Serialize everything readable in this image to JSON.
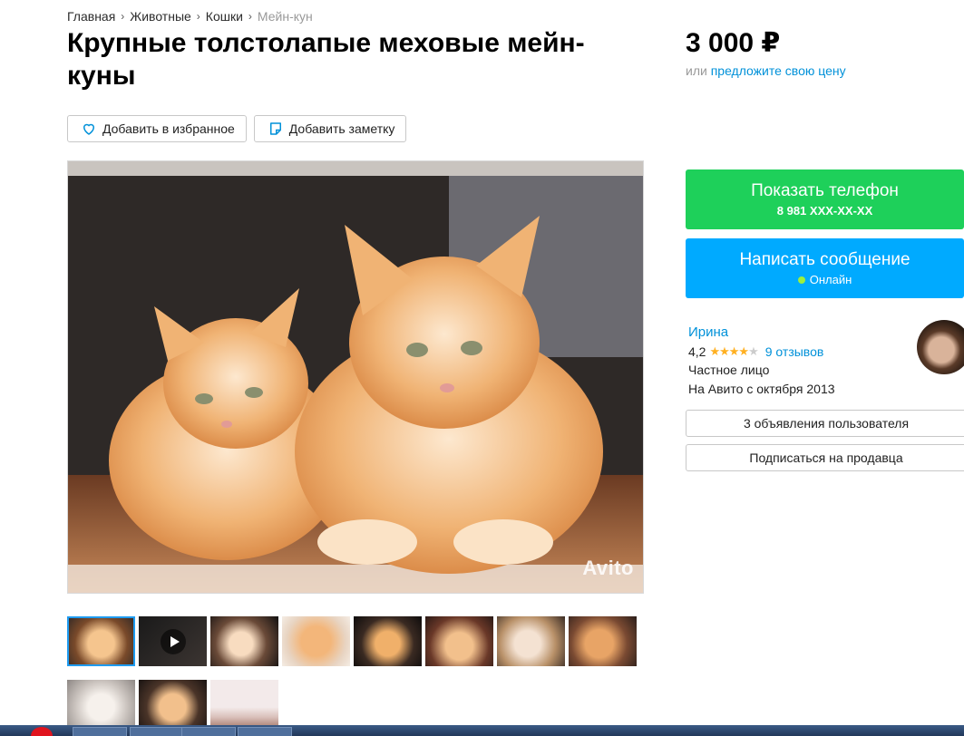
{
  "breadcrumb": {
    "items": [
      "Главная",
      "Животные",
      "Кошки"
    ],
    "current": "Мейн-кун"
  },
  "listing": {
    "title": "Крупные толстолапые меховые мейн-куны",
    "favorite_label": "Добавить в избранное",
    "note_label": "Добавить заметку",
    "watermark": "Avito"
  },
  "price": {
    "value": "3 000 ₽",
    "prefix": "или",
    "offer_link": "предложите свою цену"
  },
  "contact": {
    "phone_label": "Показать телефон",
    "phone_number": "8 981 XXX-XX-XX",
    "message_label": "Написать сообщение",
    "online_label": "Онлайн"
  },
  "seller": {
    "name": "Ирина",
    "rating": "4,2",
    "stars_filled": 4,
    "stars_total": 5,
    "reviews": "9 отзывов",
    "type": "Частное лицо",
    "since": "На Авито с октября 2013",
    "ads_button": "3 объявления пользователя",
    "subscribe_button": "Подписаться на продавца"
  },
  "thumbnails": {
    "count": 11,
    "selected_index": 0,
    "video_index": 1
  },
  "colors": {
    "green_cta": "#1ed05a",
    "blue_cta": "#00aaff",
    "link": "#0091d9",
    "star": "#ffb021"
  }
}
